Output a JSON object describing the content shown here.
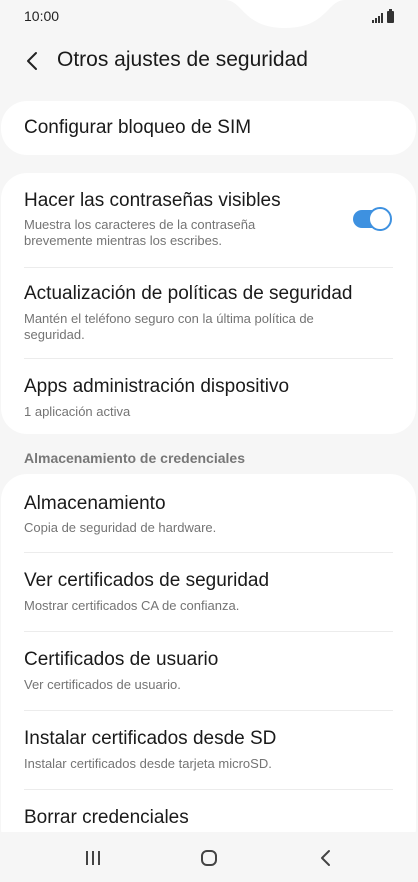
{
  "status_bar": {
    "time": "10:00"
  },
  "header": {
    "title": "Otros ajustes de seguridad"
  },
  "sim_card": {
    "label": "Configurar bloqueo de SIM"
  },
  "security_card": {
    "items": [
      {
        "title": "Hacer las contraseñas visibles",
        "subtitle": "Muestra los caracteres de la contraseña brevemente mientras los escribes.",
        "toggle": true
      },
      {
        "title": "Actualización de políticas de seguridad",
        "subtitle": "Mantén el teléfono seguro con la última política de seguridad."
      },
      {
        "title": "Apps administración dispositivo",
        "subtitle": "1 aplicación activa"
      }
    ]
  },
  "credentials": {
    "header": "Almacenamiento de credenciales",
    "items": [
      {
        "title": "Almacenamiento",
        "subtitle": "Copia de seguridad de hardware."
      },
      {
        "title": "Ver certificados de seguridad",
        "subtitle": "Mostrar certificados CA de confianza."
      },
      {
        "title": "Certificados de usuario",
        "subtitle": "Ver certificados de usuario."
      },
      {
        "title": "Instalar certificados desde SD",
        "subtitle": "Instalar certificados desde tarjeta microSD."
      },
      {
        "title": "Borrar credenciales"
      }
    ]
  },
  "colors": {
    "accent": "#3e91e0",
    "background": "#f6f6f6",
    "card": "#ffffff"
  },
  "icons": [
    "back-arrow-icon",
    "signal-icon",
    "battery-icon",
    "recent-apps-icon",
    "home-icon",
    "back-nav-icon"
  ]
}
